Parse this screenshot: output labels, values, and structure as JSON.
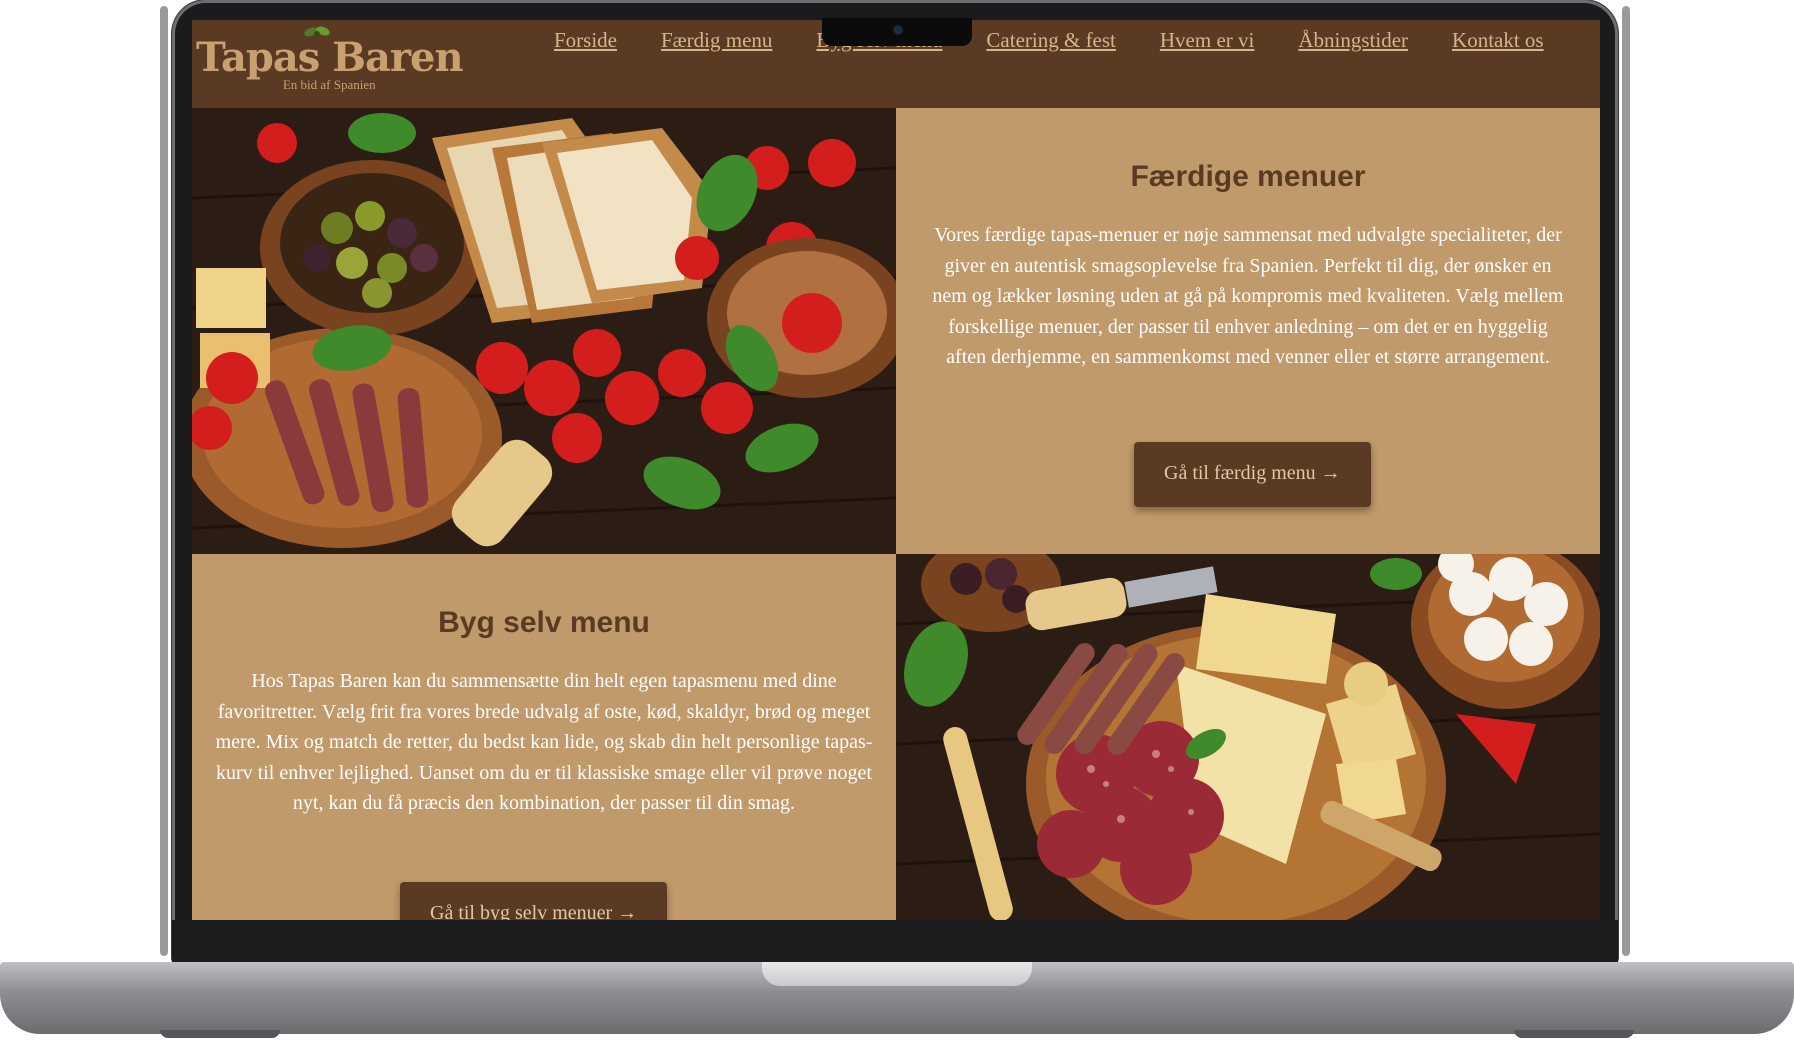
{
  "site": {
    "brand": {
      "title": "Tapas Baren",
      "subtitle": "En bid af Spanien"
    },
    "nav": [
      {
        "label": "Forside"
      },
      {
        "label": "Færdig menu"
      },
      {
        "label": "Byg selv menu"
      },
      {
        "label": "Catering & fest"
      },
      {
        "label": "Hvem er vi"
      },
      {
        "label": "Åbningstider"
      },
      {
        "label": "Kontakt os"
      }
    ]
  },
  "sections": {
    "faerdige": {
      "title": "Færdige menuer",
      "text": "Vores færdige tapas-menuer er nøje sammensat med udvalgte specialiteter, der giver en autentisk smagsoplevelse fra Spanien. Perfekt til dig, der ønsker en nem og lækker løsning uden at gå på kompromis med kvaliteten. Vælg mellem forskellige menuer, der passer til enhver anledning – om det er en hyggelig aften derhjemme, en sammenkomst med venner eller et større arrangement.",
      "button": "Gå til færdig menu →"
    },
    "byg": {
      "title": "Byg selv menu",
      "text": "Hos Tapas Baren kan du sammensætte din helt egen tapasmenu med dine favoritretter. Vælg frit fra vores brede udvalg af oste, kød, skaldyr, brød og meget mere. Mix og match de retter, du bedst kan lide, og skab din helt personlige tapas-kurv til enhver lejlighed. Uanset om du er til klassiske smage eller vil prøve noget nyt, kan du få præcis den kombination, der passer til din smag.",
      "button": "Gå til byg selv menuer →"
    }
  },
  "colors": {
    "header_brown": "#5a3a22",
    "tan": "#c19a6b",
    "nav_link": "#d6b48c",
    "button_text": "#e2c8a6"
  },
  "icons": {
    "logo_leaf": "olive-leaf-icon",
    "arrow": "right-arrow"
  }
}
